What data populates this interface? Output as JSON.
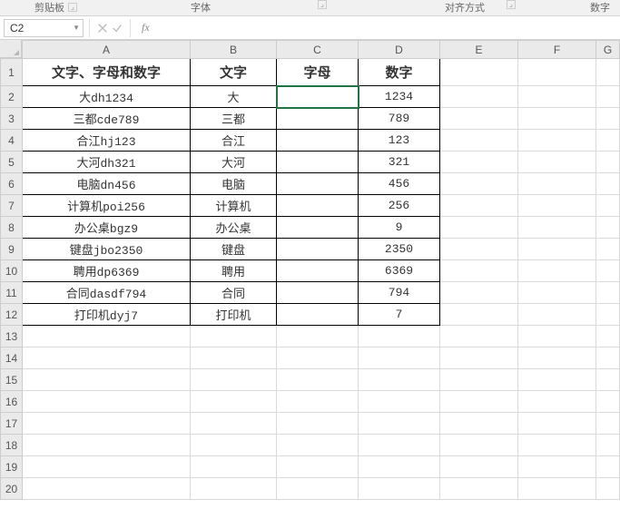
{
  "ribbon_groups": {
    "clipboard": "剪贴板",
    "font": "字体",
    "alignment": "对齐方式",
    "number": "数字"
  },
  "namebox": {
    "value": "C2"
  },
  "formula_bar": {
    "fx": "fx",
    "value": ""
  },
  "columns": [
    "A",
    "B",
    "C",
    "D",
    "E",
    "F",
    "G"
  ],
  "row_count": 20,
  "headers": {
    "A": "文字、字母和数字",
    "B": "文字",
    "C": "字母",
    "D": "数字"
  },
  "active_cell": "C2",
  "chart_data": {
    "type": "table",
    "columns": [
      "文字、字母和数字",
      "文字",
      "字母",
      "数字"
    ],
    "rows": [
      {
        "A": "大dh1234",
        "B": "大",
        "C": "",
        "D": "1234"
      },
      {
        "A": "三都cde789",
        "B": "三都",
        "C": "",
        "D": "789"
      },
      {
        "A": "合江hj123",
        "B": "合江",
        "C": "",
        "D": "123"
      },
      {
        "A": "大河dh321",
        "B": "大河",
        "C": "",
        "D": "321"
      },
      {
        "A": "电脑dn456",
        "B": "电脑",
        "C": "",
        "D": "456"
      },
      {
        "A": "计算机poi256",
        "B": "计算机",
        "C": "",
        "D": "256"
      },
      {
        "A": "办公桌bgz9",
        "B": "办公桌",
        "C": "",
        "D": "9"
      },
      {
        "A": "键盘jbo2350",
        "B": "键盘",
        "C": "",
        "D": "2350"
      },
      {
        "A": "聘用dp6369",
        "B": "聘用",
        "C": "",
        "D": "6369"
      },
      {
        "A": "合同dasdf794",
        "B": "合同",
        "C": "",
        "D": "794"
      },
      {
        "A": "打印机dyj7",
        "B": "打印机",
        "C": "",
        "D": "7"
      }
    ]
  }
}
